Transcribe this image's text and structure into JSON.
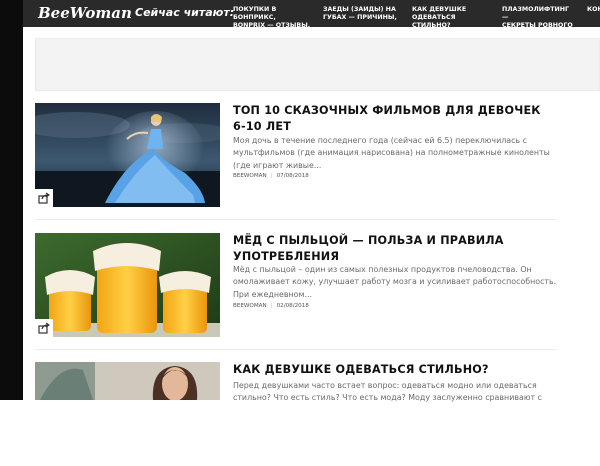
{
  "header": {
    "logo": "BeeWoman",
    "now_reading_label": "Сейчас читают:",
    "now_reading": [
      "Покупки в Бонприкс,\nBonprix — отзывы,",
      "Заеды (заиды) на\nгубах — причины,",
      "Как девушке\nодеваться стильно?",
      "Плазмолифтинг —\nсекреты ровного",
      "Кон"
    ]
  },
  "colors": {
    "topbar": "#2a2a2a",
    "left_bar": "#0c0c0c",
    "title": "#111111",
    "excerpt": "#6a6a6a",
    "ad_background": "#f3f3f3"
  },
  "articles": [
    {
      "title": "ТОП 10 сказочных фильмов для девочек 6-10 лет",
      "excerpt": "Моя дочь в течение последнего года (сейчас ей 6.5) переключилась с мультфильмов (где анимация нарисована) на полнометражные киноленты (где играют живые...",
      "author": "beewoman",
      "date": "07/08/2018",
      "image": "princess-blue-dress"
    },
    {
      "title": "Мёд с пыльцой — польза и правила употребления",
      "excerpt": "Мёд с пыльцой – один из самых полезных продуктов пчеловодства. Он омолаживает кожу, улучшает работу мозга и усиливает работоспособность. При ежедневном...",
      "author": "beewoman",
      "date": "02/08/2018",
      "image": "honey-jars"
    },
    {
      "title": "Как девушке одеваться стильно?",
      "excerpt": "Перед девушками часто встает вопрос: одеваться модно или одеваться стильно? Что есть стиль? Что есть мода? Моду заслуженно сравнивают с",
      "author": "",
      "date": "",
      "image": "woman-portrait"
    }
  ]
}
